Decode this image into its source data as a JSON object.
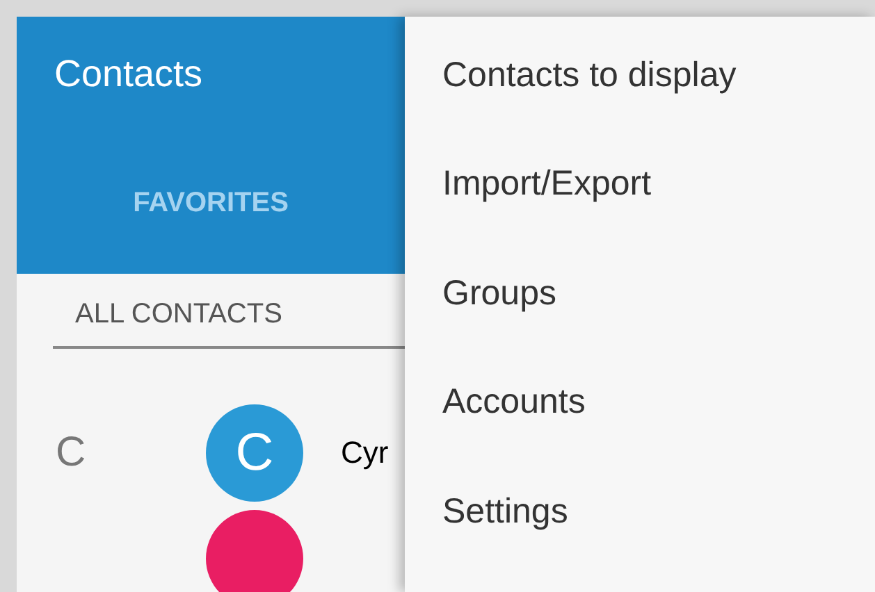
{
  "app_bar": {
    "title": "Contacts"
  },
  "tabs": [
    {
      "label": "FAVORITES",
      "selected": false
    },
    {
      "label": "ALL CONTACTS",
      "selected": true
    }
  ],
  "contacts": [
    {
      "section": "C",
      "initial": "C",
      "name": "Cyr",
      "color": "#2a9ad6"
    },
    {
      "color": "#e91e63"
    }
  ],
  "menu": {
    "items": [
      "Contacts to display",
      "Import/Export",
      "Groups",
      "Accounts",
      "Settings"
    ]
  }
}
